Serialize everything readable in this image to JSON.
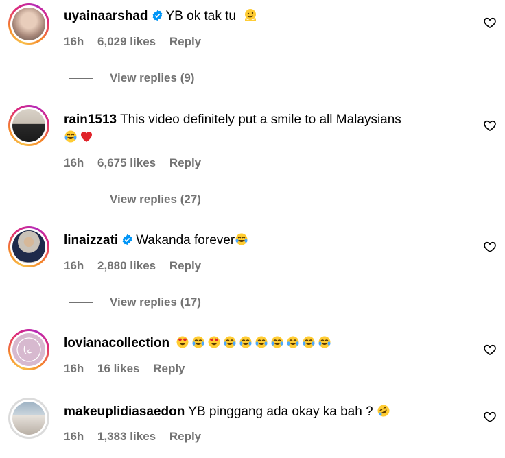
{
  "comments": [
    {
      "username": "uyainaarshad",
      "verified": true,
      "text": "YB ok tak tu",
      "emoji": [
        "melting-face"
      ],
      "time": "16h",
      "likes": "6,029 likes",
      "reply": "Reply",
      "view_replies": "View replies (9)"
    },
    {
      "username": "rain1513",
      "verified": false,
      "text": "This video definitely put a smile to all Malaysians",
      "emoji": [
        "tears-of-joy",
        "red-heart"
      ],
      "time": "16h",
      "likes": "6,675 likes",
      "reply": "Reply",
      "view_replies": "View replies (27)"
    },
    {
      "username": "linaizzati",
      "verified": true,
      "text": "Wakanda forever",
      "emoji": [
        "tears-of-joy"
      ],
      "time": "16h",
      "likes": "2,880 likes",
      "reply": "Reply",
      "view_replies": "View replies (17)"
    },
    {
      "username": "lovianacollection",
      "verified": false,
      "text": "",
      "emoji": [
        "heart-eyes",
        "tears-of-joy",
        "heart-eyes",
        "tears-of-joy",
        "tears-of-joy",
        "tears-of-joy",
        "tears-of-joy",
        "tears-of-joy",
        "tears-of-joy",
        "tears-of-joy"
      ],
      "time": "16h",
      "likes": "16 likes",
      "reply": "Reply"
    },
    {
      "username": "makeuplidiasaedon",
      "verified": false,
      "text": "YB pinggang ada okay ka bah ?",
      "emoji": [
        "rolling-laughing"
      ],
      "time": "16h",
      "likes": "1,383 likes",
      "reply": "Reply"
    }
  ],
  "colors": {
    "secondary_text": "#737373",
    "verified_blue": "#0095f6",
    "story_ring": "#dd2a7b"
  },
  "icons": {
    "like": "heart-outline-icon",
    "verified": "verified-badge-icon"
  }
}
